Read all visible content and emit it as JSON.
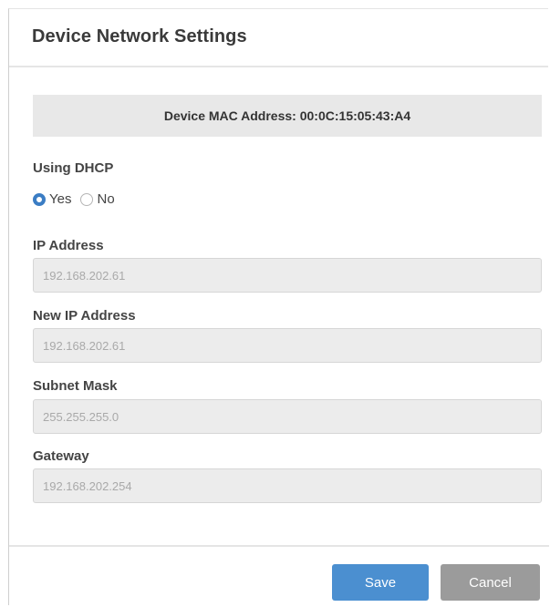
{
  "dialog": {
    "title": "Device Network Settings"
  },
  "mac": {
    "label": "Device MAC Address:",
    "value": "00:0C:15:05:43:A4"
  },
  "dhcp": {
    "label": "Using DHCP",
    "options": [
      {
        "label": "Yes",
        "selected": true
      },
      {
        "label": "No",
        "selected": false
      }
    ]
  },
  "fields": {
    "ip_address": {
      "label": "IP Address",
      "value": "192.168.202.61"
    },
    "new_ip_address": {
      "label": "New IP Address",
      "value": "192.168.202.61"
    },
    "subnet_mask": {
      "label": "Subnet Mask",
      "value": "255.255.255.0"
    },
    "gateway": {
      "label": "Gateway",
      "value": "192.168.202.254"
    }
  },
  "buttons": {
    "save": "Save",
    "cancel": "Cancel"
  },
  "colors": {
    "accent": "#3b7dc4",
    "save_button": "#4b8fd0",
    "cancel_button": "#9b9b9b",
    "disabled_field": "#ececec"
  },
  "icons": {
    "radio_selected": "radio-selected-icon",
    "radio_unselected": "radio-unselected-icon"
  }
}
